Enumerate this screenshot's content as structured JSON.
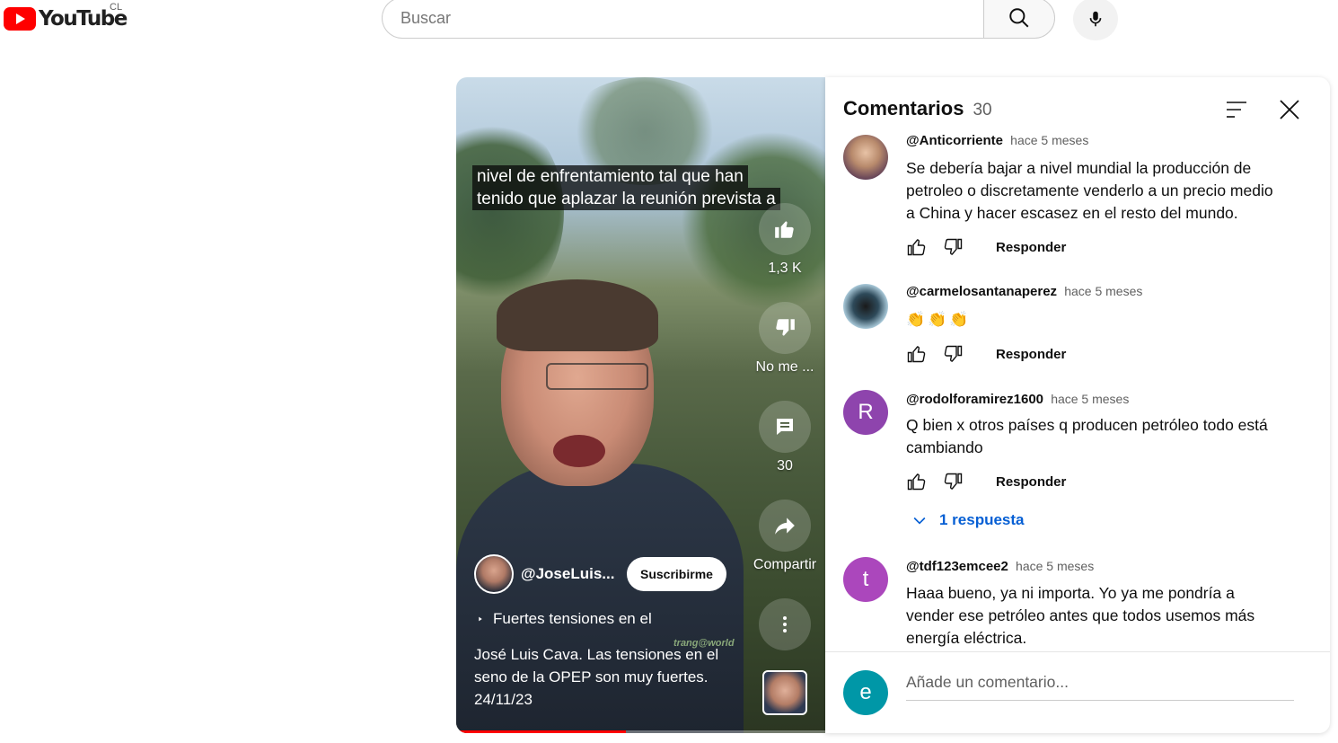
{
  "header": {
    "logo_text": "YouTube",
    "country_code": "CL",
    "search_placeholder": "Buscar"
  },
  "video": {
    "subtitle_line1": "nivel de enfrentamiento tal que han",
    "subtitle_line2": "tenido que aplazar la reunión prevista a",
    "likes": "1,3 K",
    "dislike_label": "No me ...",
    "comments_count": "30",
    "share_label": "Compartir",
    "channel_name": "@JoseLuis...",
    "subscribe_label": "Suscribirme",
    "title": "Fuertes tensiones en el",
    "description": "José Luis Cava. Las tensiones en el seno de la OPEP son muy fuertes. 24/11/23",
    "watermark": "trang@world",
    "progress": 0.46
  },
  "comments_panel": {
    "title": "Comentarios",
    "count": "30",
    "reply_label": "Responder",
    "add_placeholder": "Añade un comentario...",
    "user_initial": "e",
    "comments": [
      {
        "author": "@Anticorriente",
        "time": "hace 5 meses",
        "text": "Se debería bajar a nivel mundial la producción de petroleo o discretamente venderlo a un precio medio a China y hacer escasez en el resto del mundo."
      },
      {
        "author": "@carmelosantanaperez",
        "time": "hace 5 meses",
        "text": "👏👏👏"
      },
      {
        "author": "@rodolforamirez1600",
        "time": "hace 5 meses",
        "initial": "R",
        "text": "Q bien x otros países q producen petróleo todo está cambiando",
        "replies": "1 respuesta"
      },
      {
        "author": "@tdf123emcee2",
        "time": "hace 5 meses",
        "initial": "t",
        "text": "Haaa bueno, ya ni importa. Yo ya me pondría a vender ese petróleo antes que todos usemos más energía eléctrica."
      }
    ]
  },
  "colors": {
    "brand_red": "#ff0000",
    "link_blue": "#065fd4",
    "avatar_purple": "#8e44ad",
    "avatar_teal": "#0097a7"
  }
}
